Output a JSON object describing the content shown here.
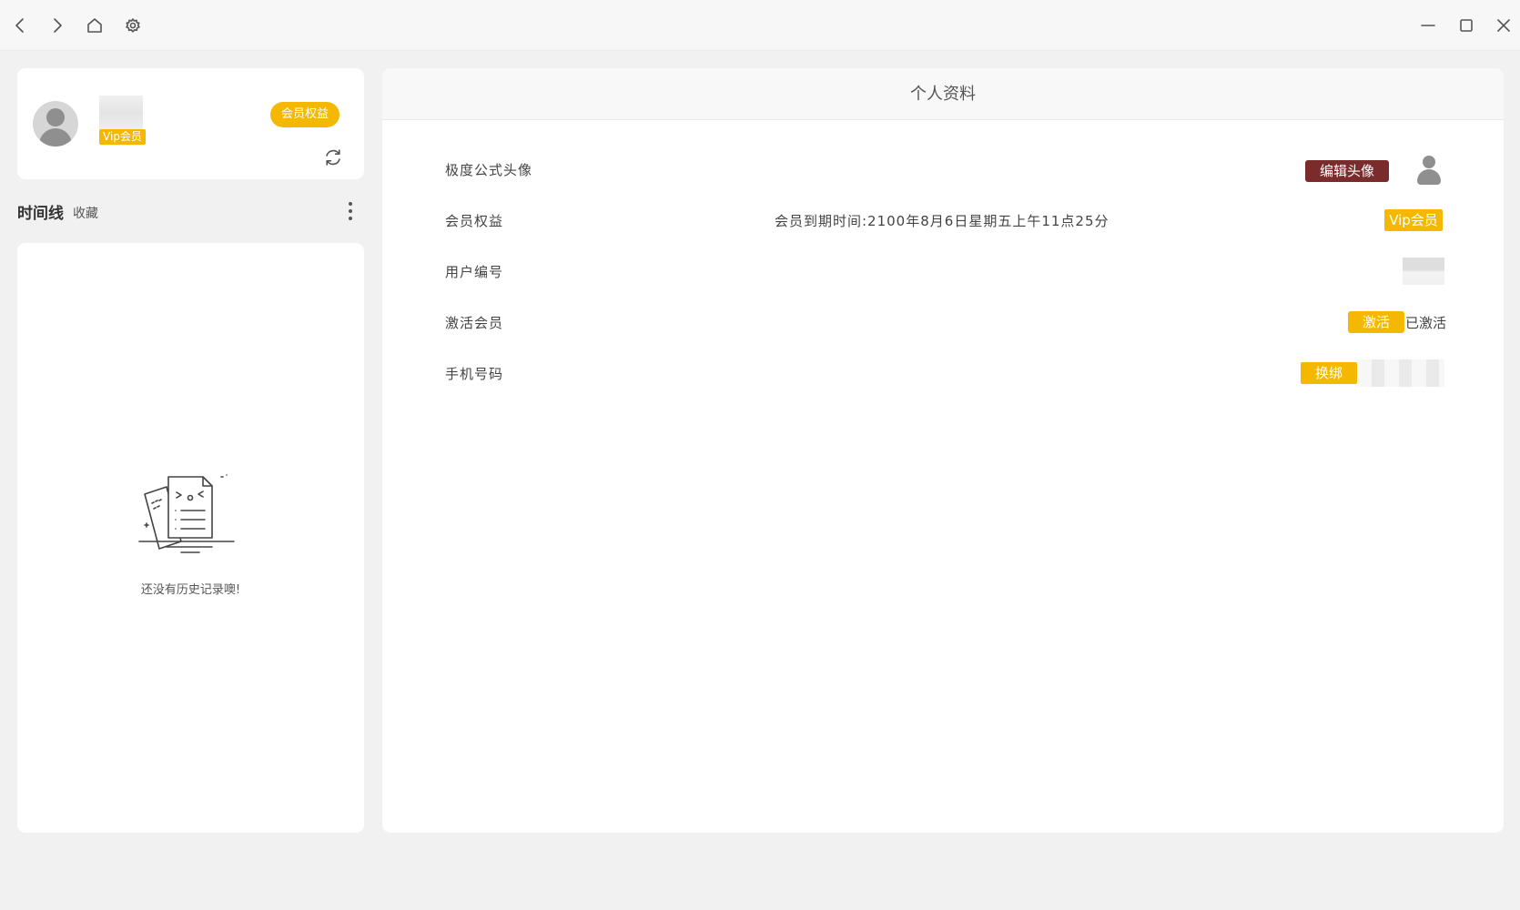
{
  "titlebar": {
    "icons": [
      "back-icon",
      "forward-icon",
      "home-icon",
      "settings-icon",
      "minimize-icon",
      "maximize-icon",
      "close-icon"
    ]
  },
  "profile": {
    "vip_tag": "Vip会员",
    "member_button": "会员权益"
  },
  "tabs": {
    "timeline": "时间线",
    "favorites": "收藏"
  },
  "history": {
    "empty_text": "还没有历史记录噢!"
  },
  "detail": {
    "title": "个人资料",
    "rows": [
      {
        "label": "极度公式头像",
        "action": "编辑头像"
      },
      {
        "label": "会员权益",
        "info": "会员到期时间:2100年8月6日星期五上午11点25分",
        "badge": "Vip会员"
      },
      {
        "label": "用户编号"
      },
      {
        "label": "激活会员",
        "action": "激活",
        "status": "已激活"
      },
      {
        "label": "手机号码",
        "action": "换绑"
      }
    ]
  },
  "colors": {
    "accent": "#f5b800",
    "edit_button": "#7a2b2b",
    "background": "#f1f1f1",
    "card": "#ffffff"
  }
}
